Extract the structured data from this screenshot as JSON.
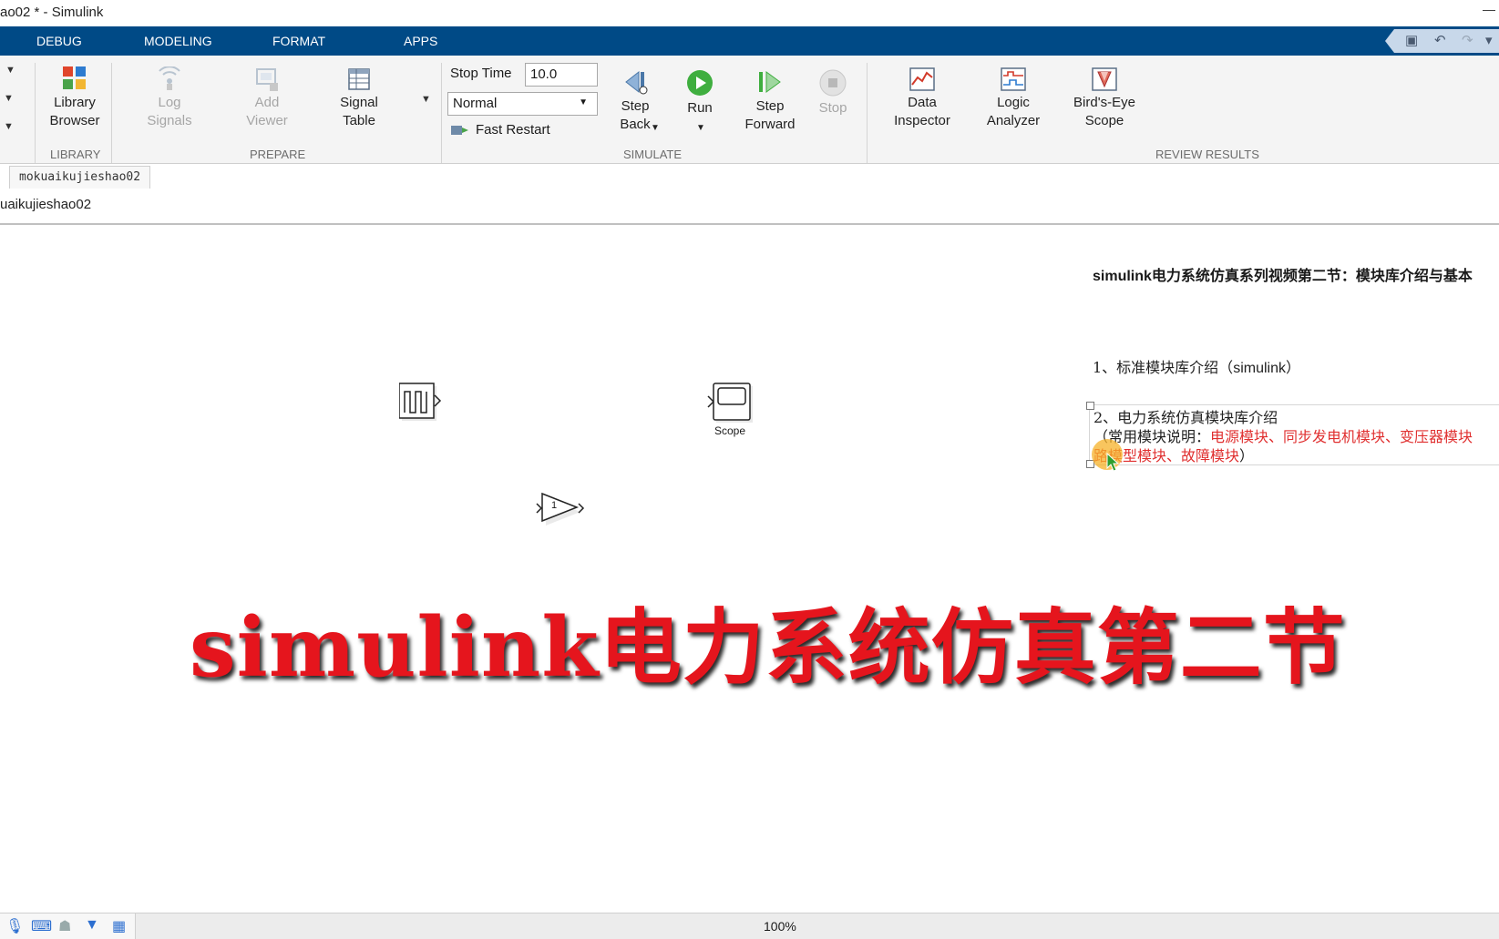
{
  "window": {
    "title": "ao02 * - Simulink"
  },
  "menu": {
    "items": [
      {
        "label": "DEBUG"
      },
      {
        "label": "MODELING"
      },
      {
        "label": "FORMAT"
      },
      {
        "label": "APPS"
      }
    ]
  },
  "ribbon": {
    "library": {
      "library_browser": "Library\nBrowser",
      "group": "LIBRARY"
    },
    "prepare": {
      "log_signals": "Log\nSignals",
      "add_viewer": "Add\nViewer",
      "signal_table": "Signal\nTable",
      "group": "PREPARE"
    },
    "simulate": {
      "stop_time_label": "Stop Time",
      "stop_time_value": "10.0",
      "mode_value": "Normal",
      "fast_restart": "Fast Restart",
      "step_back": "Step\nBack",
      "run": "Run",
      "step_forward": "Step\nForward",
      "stop": "Stop",
      "group": "SIMULATE"
    },
    "review": {
      "data_inspector": "Data\nInspector",
      "logic_analyzer": "Logic\nAnalyzer",
      "birds_eye": "Bird's-Eye\nScope",
      "group": "REVIEW RESULTS"
    }
  },
  "model_tab": {
    "label": "mokuaikujieshao02"
  },
  "breadcrumb": {
    "label": "uaikujieshao02"
  },
  "canvas": {
    "scope_label": "Scope",
    "gain_value": "1",
    "notes": {
      "heading_bold": "simulink",
      "heading_rest": "电力系统仿真系列视频第二节：模块库介绍与基本",
      "item1_prefix": "1、标准模块库介绍（",
      "item1_term": "simulink",
      "item1_suffix": "）",
      "item2": "2、电力系统仿真模块库介绍",
      "item2_sub_prefix": "（常用模块说明：",
      "item2_sub_red": "电源模块、同步发电机模块、变压器模块",
      "item2_line3_red": "路模型模块、故障模块",
      "item2_line3_suffix": "）"
    },
    "overlay_title": "simulink电力系统仿真第二节"
  },
  "status": {
    "zoom": "100%"
  },
  "colors": {
    "menubar": "#004a86",
    "overlay_title": "#e5151d",
    "note_red": "#e03030"
  }
}
